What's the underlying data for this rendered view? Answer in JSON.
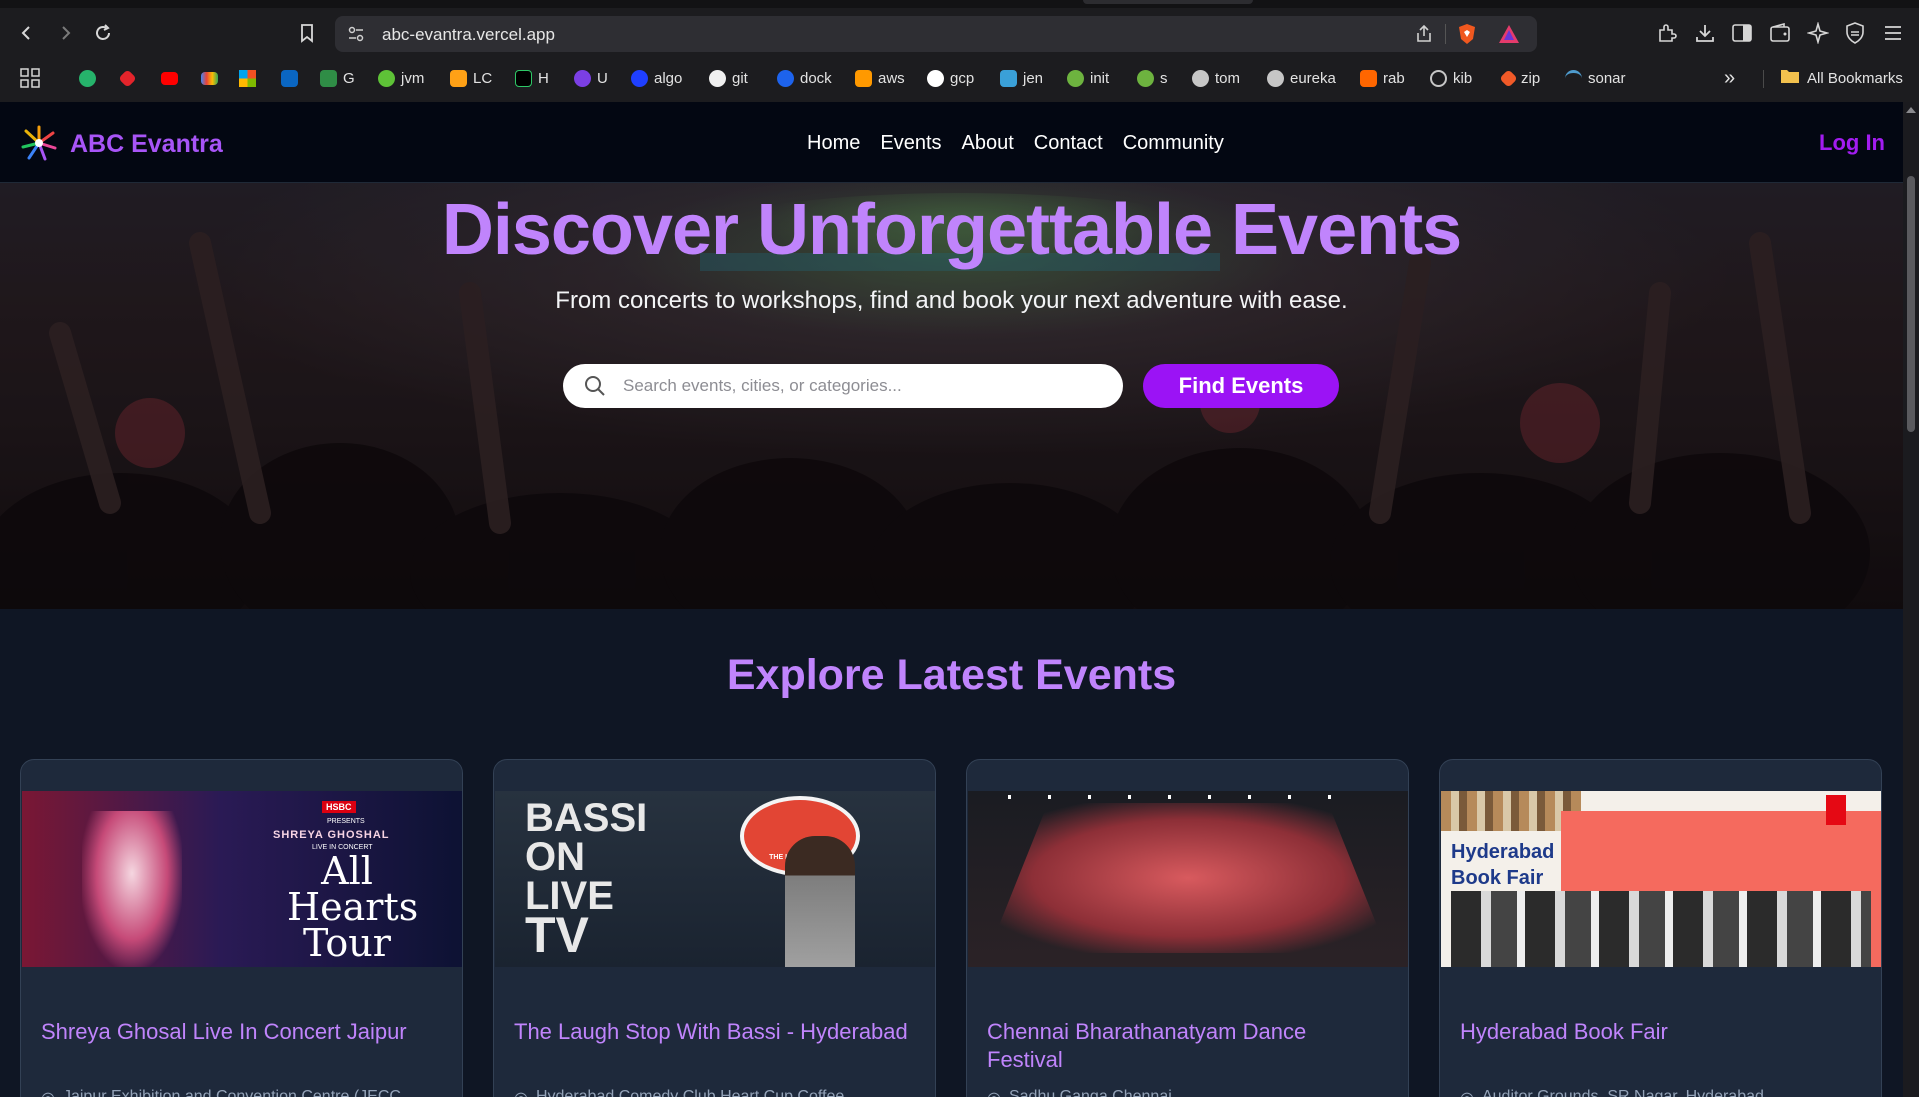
{
  "browser": {
    "url": "abc-evantra.vercel.app",
    "bookmarks": [
      "",
      "",
      "",
      "",
      "",
      "",
      "G",
      "jvm",
      "LC",
      "H",
      "U",
      "algo",
      "git",
      "dock",
      "aws",
      "gcp",
      "jen",
      "init",
      "s",
      "tom",
      "eureka",
      "rab",
      "kib",
      "zip",
      "sonar"
    ],
    "all_bookmarks_label": "All Bookmarks",
    "overflow_label": "»"
  },
  "site": {
    "brand": "ABC Evantra",
    "nav": [
      "Home",
      "Events",
      "About",
      "Contact",
      "Community"
    ],
    "login_label": "Log In"
  },
  "hero": {
    "title": "Discover Unforgettable Events",
    "subtitle": "From concerts to workshops, find and book your next adventure with ease.",
    "search_placeholder": "Search events, cities, or categories...",
    "search_value": "",
    "button_label": "Find Events"
  },
  "latest": {
    "title": "Explore Latest Events",
    "events": [
      {
        "title": "Shreya Ghosal Live In Concert Jaipur",
        "location": "Jaipur Exhibition and Convention Centre (JECC",
        "image": {
          "brand": "HSBC",
          "presents": "PRESENTS",
          "artist": "SHREYA GHOSHAL",
          "sub": "LIVE IN CONCERT",
          "line1": "All",
          "line2": "Hearts",
          "line3": "Tour"
        }
      },
      {
        "title": "The Laugh Stop With Bassi - Hyderabad",
        "location": "Hyderabad Comedy Club Heart Cup Coffee",
        "image": {
          "line1": "BASSI",
          "line2": "ON",
          "line3": "LIVE",
          "line4": "TV",
          "badge": "THE LAUGH STOP"
        }
      },
      {
        "title": "Chennai Bharathanatyam Dance Festival",
        "location": "Sadhu Ganga Chennai",
        "image": {}
      },
      {
        "title": "Hyderabad Book Fair",
        "location": "Auditor Grounds, SR Nagar, Hyderabad",
        "image": {
          "line1": "Hyderabad",
          "line2": "Book Fair"
        }
      }
    ]
  },
  "colors": {
    "accent": "#a855f7",
    "title": "#c084fc",
    "button": "#9b13f5",
    "bg": "#0f1624",
    "card": "#1e293b"
  }
}
